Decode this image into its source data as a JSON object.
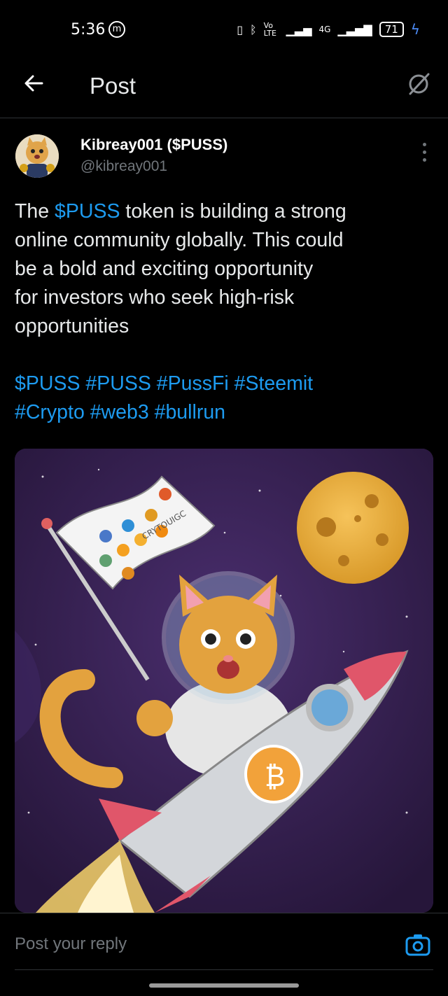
{
  "status_bar": {
    "time": "5:36",
    "carrier_icon": "m-circle-icon",
    "volte": "Vo LTE",
    "network": "4G",
    "battery": "71",
    "charging": true
  },
  "header": {
    "title": "Post",
    "back_icon": "arrow-left-icon",
    "grok_icon": "grok-icon"
  },
  "post": {
    "author_name": "Kibreay001 ($PUSS)",
    "author_handle": "@kibreay001",
    "text_lines": [
      {
        "pre": "The ",
        "link": "$PUSS",
        "post": " token is building a strong"
      },
      {
        "text": "online community globally. This could"
      },
      {
        "text": "be a bold and exciting opportunity"
      },
      {
        "text": "for investors who seek high-risk"
      },
      {
        "text": "opportunities"
      }
    ],
    "hashtag_lines": [
      "$PUSS #PUSS #PussFi #Steemit",
      "#Crypto #web3 #bullrun"
    ],
    "image_description_text": "CRYTOUIGC"
  },
  "reply": {
    "placeholder": "Post your reply"
  },
  "colors": {
    "accent": "#1d9bf0",
    "background": "#000000",
    "muted": "#71767b",
    "text": "#e7e9ea"
  }
}
